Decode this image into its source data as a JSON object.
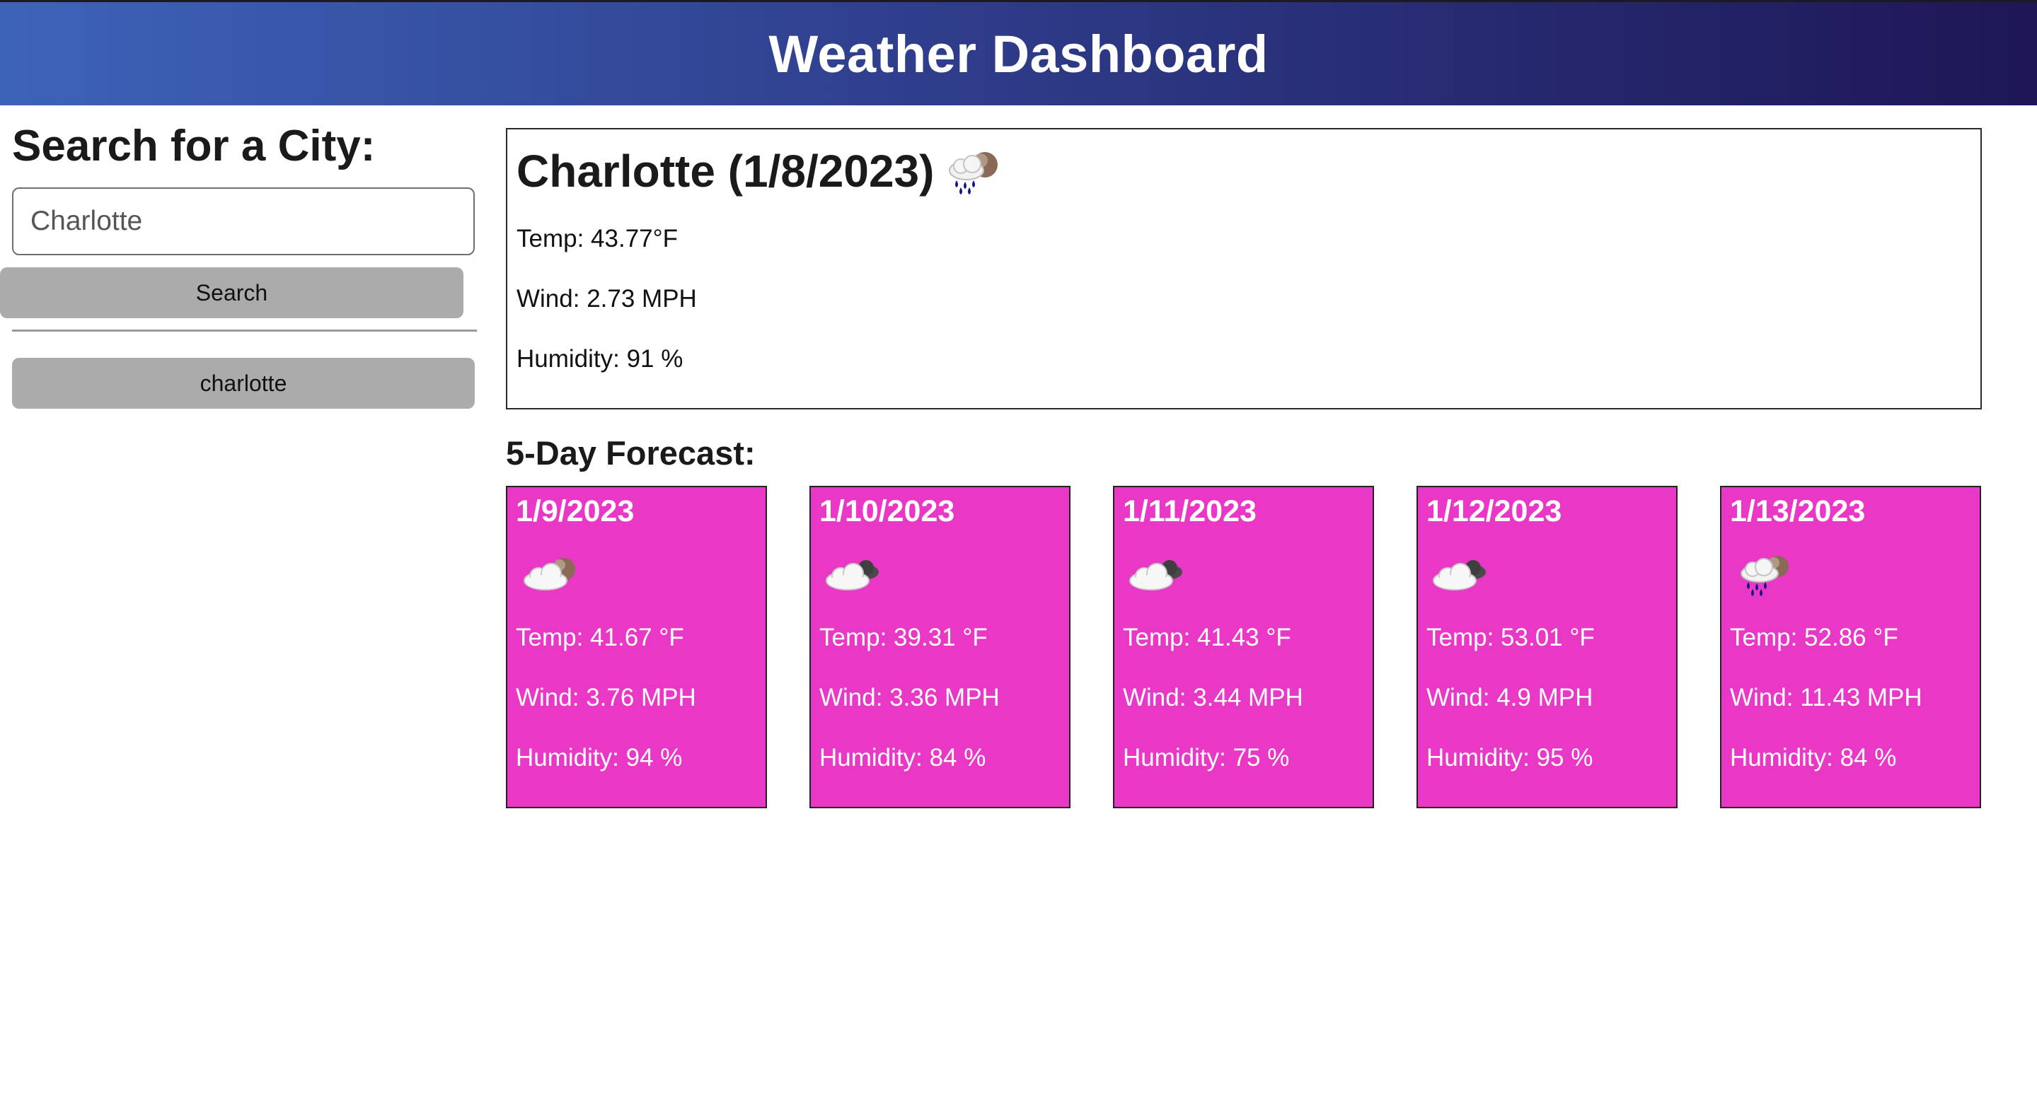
{
  "header": {
    "title": "Weather Dashboard"
  },
  "sidebar": {
    "heading": "Search for a City:",
    "search_input": {
      "value": "Charlotte",
      "placeholder": ""
    },
    "search_button": "Search",
    "history": [
      "charlotte"
    ]
  },
  "current": {
    "title": "Charlotte (1/8/2023)",
    "icon": "rain-cloud-icon",
    "temp": "Temp: 43.77°F",
    "wind": "Wind: 2.73 MPH",
    "humidity": "Humidity: 91 %"
  },
  "forecast": {
    "title": "5-Day Forecast:",
    "card_color": "#ea38c6",
    "days": [
      {
        "date": "1/9/2023",
        "icon": "partly-cloudy-icon",
        "temp": "Temp: 41.67 °F",
        "wind": "Wind: 3.76 MPH",
        "humidity": "Humidity: 94 %"
      },
      {
        "date": "1/10/2023",
        "icon": "cloudy-icon",
        "temp": "Temp: 39.31 °F",
        "wind": "Wind: 3.36 MPH",
        "humidity": "Humidity: 84 %"
      },
      {
        "date": "1/11/2023",
        "icon": "cloudy-icon",
        "temp": "Temp: 41.43 °F",
        "wind": "Wind: 3.44 MPH",
        "humidity": "Humidity: 75 %"
      },
      {
        "date": "1/12/2023",
        "icon": "cloudy-icon",
        "temp": "Temp: 53.01 °F",
        "wind": "Wind: 4.9 MPH",
        "humidity": "Humidity: 95 %"
      },
      {
        "date": "1/13/2023",
        "icon": "rain-cloud-icon",
        "temp": "Temp: 52.86 °F",
        "wind": "Wind: 11.43 MPH",
        "humidity": "Humidity: 84 %"
      }
    ]
  },
  "colors": {
    "header_gradient_start": "#3d63b9",
    "header_gradient_end": "#1e1656",
    "button_gray": "#ababab"
  }
}
